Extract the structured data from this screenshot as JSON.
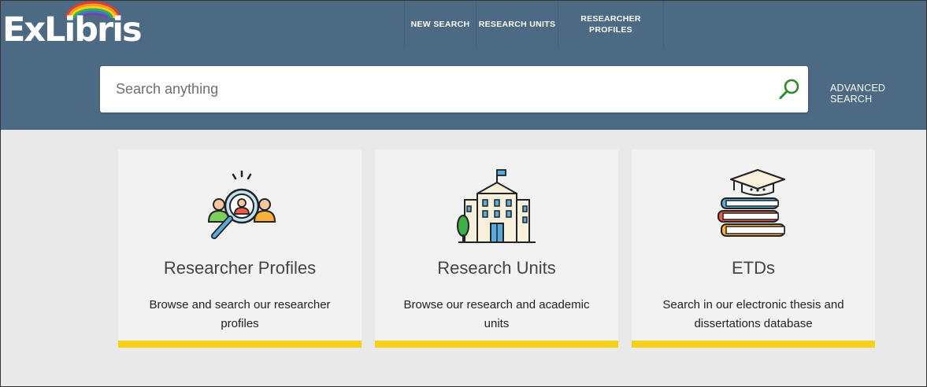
{
  "brand": {
    "logo_text": "ExLibris"
  },
  "nav": {
    "items": [
      {
        "label": "NEW SEARCH"
      },
      {
        "label": "RESEARCH UNITS"
      },
      {
        "label": "RESEARCHER PROFILES"
      }
    ]
  },
  "search": {
    "placeholder": "Search anything",
    "value": "",
    "advanced_label": "ADVANCED SEARCH"
  },
  "cards": [
    {
      "title": "Researcher Profiles",
      "description": "Browse and search our researcher profiles",
      "icon": "researcher-search-icon"
    },
    {
      "title": "Research Units",
      "description": "Browse our research and academic units",
      "icon": "university-building-icon"
    },
    {
      "title": "ETDs",
      "description": "Search in our electronic thesis and dissertations database",
      "icon": "books-graduation-cap-icon"
    }
  ],
  "colors": {
    "header": "#4d6a84",
    "background": "#e9e9e9",
    "card": "#f2f2f2",
    "accent_bar": "#f7d117",
    "search_icon": "#2e8b2e"
  }
}
